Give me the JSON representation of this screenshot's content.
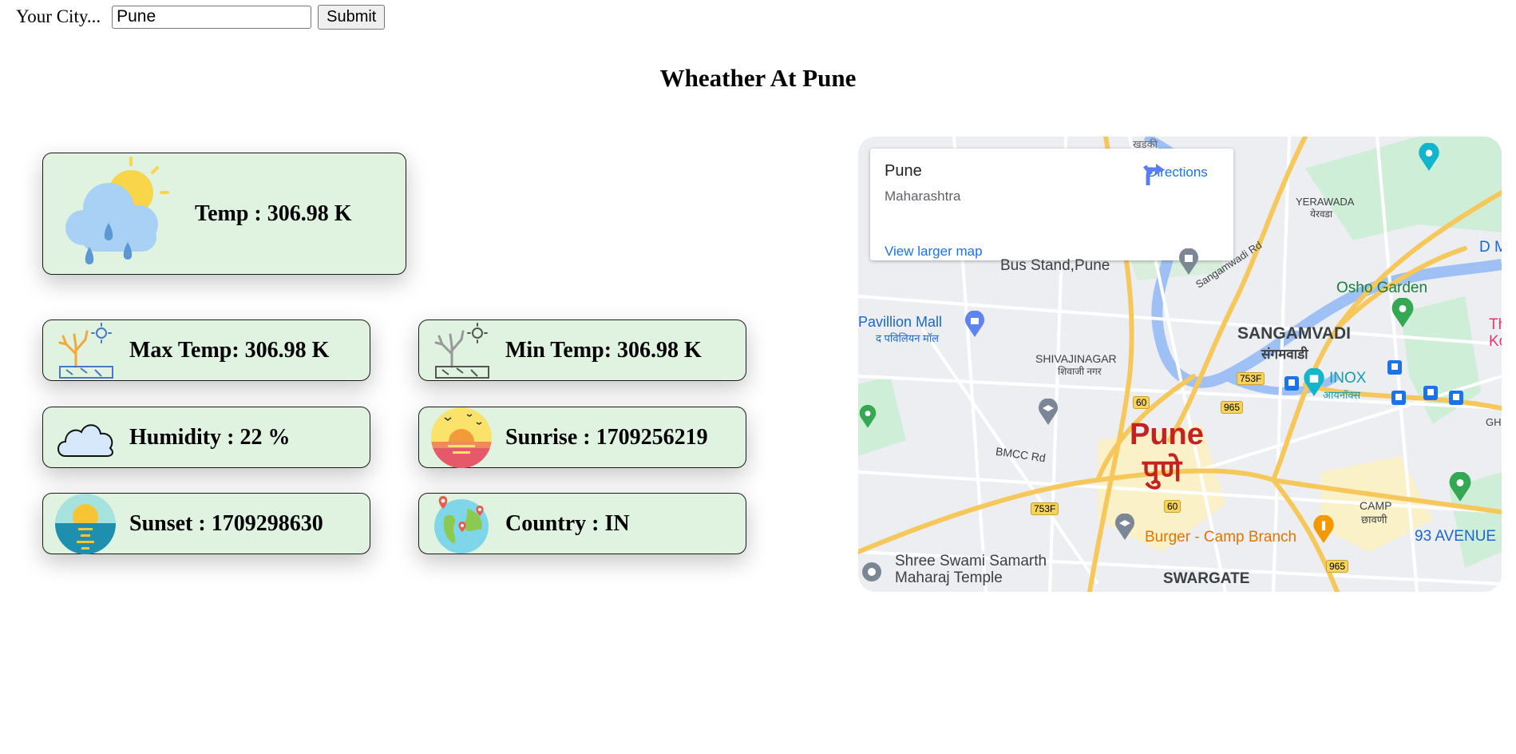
{
  "form": {
    "label": "Your City...",
    "input_value": "Pune",
    "submit_label": "Submit"
  },
  "heading": "Wheather At Pune",
  "cards": {
    "temp": "Temp : 306.98 K",
    "max_temp": "Max Temp: 306.98 K",
    "min_temp": "Min Temp: 306.98 K",
    "humidity": "Humidity : 22 %",
    "sunrise": "Sunrise : 1709256219",
    "sunset": "Sunset : 1709298630",
    "country": "Country : IN"
  },
  "card_icons": {
    "temp": "rain-cloud-sun-icon",
    "max_temp": "hot-dry-tree-icon",
    "min_temp": "dry-tree-icon",
    "humidity": "cloud-icon",
    "sunrise": "sunrise-icon",
    "sunset": "sunset-icon",
    "country": "globe-pin-icon"
  },
  "map": {
    "place_name": "Pune",
    "place_region": "Maharashtra",
    "directions_label": "Directions",
    "larger_map_link": "View larger map",
    "city_label_en": "Pune",
    "city_label_mr": "पुणे",
    "labels": {
      "bus_stand_1": "Bus Stand,Pune",
      "pavillion_mall": "Pavillion Mall",
      "pavillion_mall_mr": "द पविलियन मॉल",
      "shivajinagar": "SHIVAJINAGAR",
      "shivajinagar_mr": "शिवाजी नगर",
      "sangamvadi": "SANGAMVADI",
      "sangamvadi_mr": "संगमवाडी",
      "yerawada": "YERAWADA",
      "yerawada_mr": "येरवडा",
      "osho_garden": "Osho Garden",
      "inox": "INOX",
      "inox_mr": "आयनॉक्स",
      "sangamwadi_rd": "Sangamwadi Rd",
      "bmcc_rd": "BMCC Rd",
      "camp": "CAMP",
      "camp_mr": "छावणी",
      "burger_camp": "Burger - Camp Branch",
      "avenue": "93 AVENUE",
      "shree_swami_1": "Shree Swami Samarth",
      "shree_swami_2": "Maharaj Temple",
      "swargate": "SWARGATE",
      "khadki_mr": "खडकी",
      "d_m": "D M",
      "gh": "GH",
      "th": "Th",
      "ko": "Ko"
    },
    "shields": {
      "r60a": "60",
      "r60b": "60",
      "r753f_a": "753F",
      "r753f_b": "753F",
      "r965_a": "965",
      "r965_b": "965"
    }
  },
  "colors": {
    "card_bg": "#dff3e0",
    "map_link": "#1a73e8",
    "city_label": "#c5221f"
  }
}
